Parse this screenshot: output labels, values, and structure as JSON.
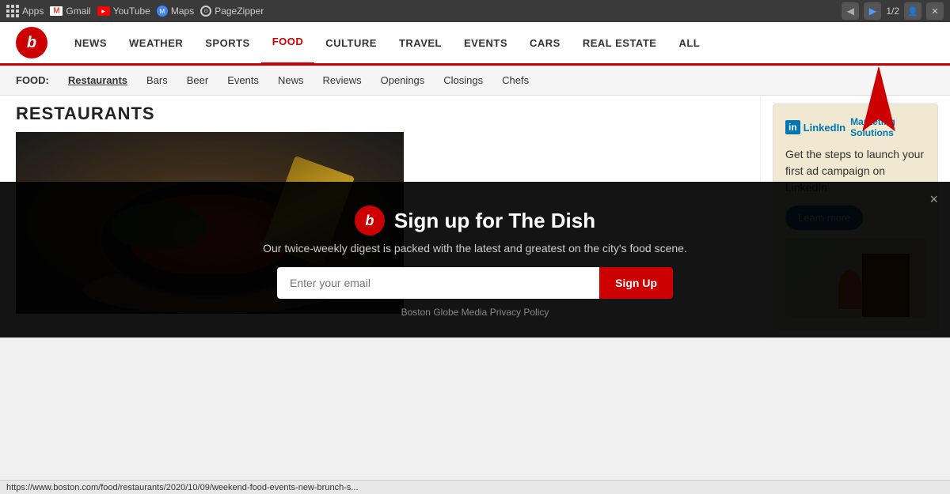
{
  "browser": {
    "toolbar": {
      "apps_label": "Apps",
      "gmail_label": "Gmail",
      "youtube_label": "YouTube",
      "maps_label": "Maps",
      "pagezipper_label": "PageZipper",
      "back_btn": "◀",
      "forward_btn": "▶",
      "page_counter": "1/2",
      "ext_btn1": "👤",
      "ext_btn2": "✕"
    }
  },
  "site": {
    "logo_letter": "b",
    "nav": {
      "items": [
        {
          "label": "NEWS",
          "active": false
        },
        {
          "label": "WEATHER",
          "active": false
        },
        {
          "label": "SPORTS",
          "active": false
        },
        {
          "label": "FOOD",
          "active": true
        },
        {
          "label": "CULTURE",
          "active": false
        },
        {
          "label": "TRAVEL",
          "active": false
        },
        {
          "label": "EVENTS",
          "active": false
        },
        {
          "label": "CARS",
          "active": false
        },
        {
          "label": "REAL ESTATE",
          "active": false
        },
        {
          "label": "ALL",
          "active": false
        }
      ]
    },
    "sub_nav": {
      "label": "FOOD:",
      "items": [
        {
          "label": "Restaurants",
          "active": true
        },
        {
          "label": "Bars",
          "active": false
        },
        {
          "label": "Beer",
          "active": false
        },
        {
          "label": "Events",
          "active": false
        },
        {
          "label": "News",
          "active": false
        },
        {
          "label": "Reviews",
          "active": false
        },
        {
          "label": "Openings",
          "active": false
        },
        {
          "label": "Closings",
          "active": false
        },
        {
          "label": "Chefs",
          "active": false
        }
      ]
    }
  },
  "main": {
    "page_heading": "RESTAURANTS",
    "image_alt": "Food dish in cast iron pan"
  },
  "linkedin_ad": {
    "logo_box": "in",
    "logo_text": "LinkedIn",
    "subtitle": "Marketing Solutions",
    "body": "Get the steps to launch your first ad campaign on LinkedIn",
    "btn_label": "Learn more"
  },
  "newsletter": {
    "logo_letter": "b",
    "title": "Sign up for The Dish",
    "description": "Our twice-weekly digest is packed with the latest and greatest on the city's food scene.",
    "email_placeholder": "Enter your email",
    "signup_btn": "Sign Up",
    "privacy_text": "Boston Globe Media Privacy Policy",
    "close_btn": "×"
  },
  "status_bar": {
    "url": "https://www.boston.com/food/restaurants/2020/10/09/weekend-food-events-new-brunch-s..."
  }
}
